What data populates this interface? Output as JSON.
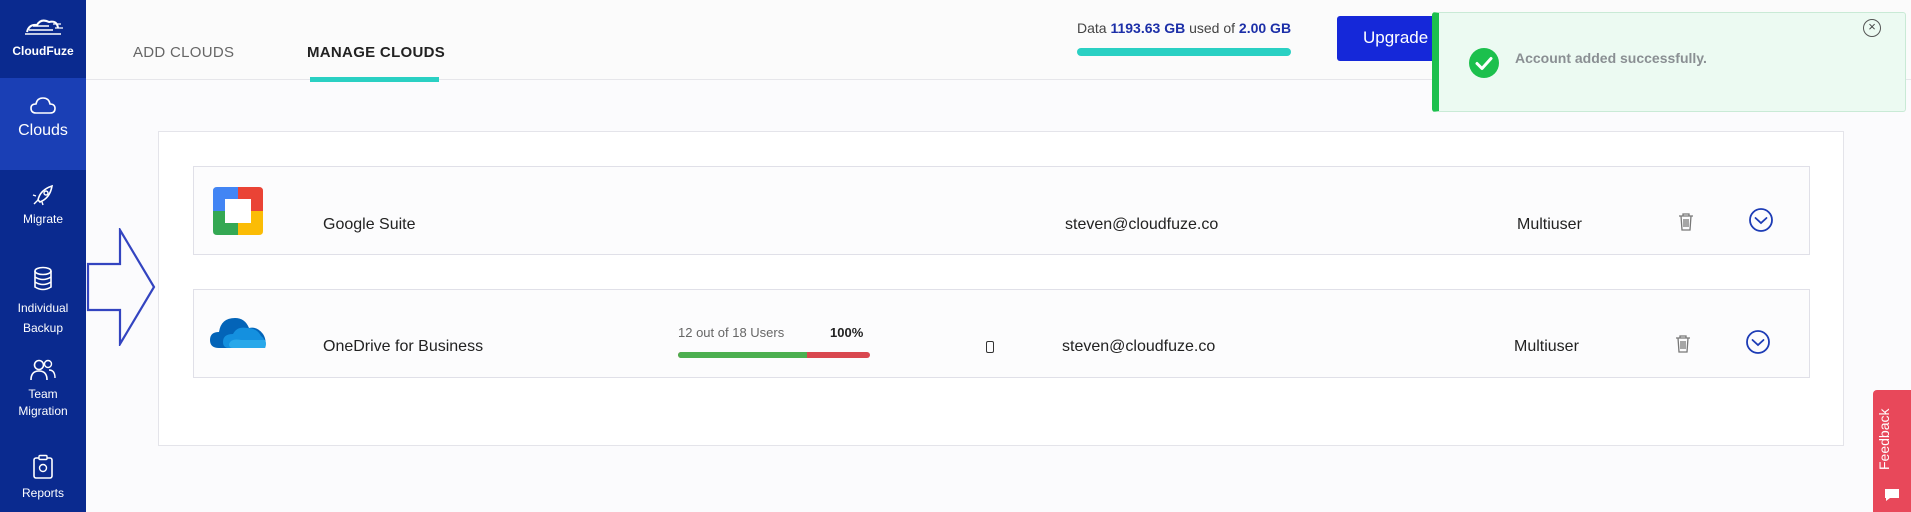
{
  "sidebar": {
    "logo_label": "CloudFuze",
    "items": [
      {
        "label": "Clouds",
        "icon": "cloud-icon"
      },
      {
        "label": "Migrate",
        "icon": "rocket-icon"
      },
      {
        "label_line1": "Individual",
        "label_line2": "Backup",
        "icon": "database-icon"
      },
      {
        "label_line1": "Team",
        "label_line2": "Migration",
        "icon": "users-icon"
      },
      {
        "label": "Reports",
        "icon": "clipboard-icon"
      }
    ]
  },
  "header": {
    "tabs": [
      {
        "label": "ADD CLOUDS"
      },
      {
        "label": "MANAGE CLOUDS"
      }
    ],
    "usage": {
      "prefix": "Data",
      "used": "1193.63 GB",
      "middle": "used of",
      "total": "2.00 GB"
    },
    "upgrade_label": "Upgrade"
  },
  "toast": {
    "message": "Account added successfully.",
    "close": "×"
  },
  "clouds": [
    {
      "name": "Google Suite",
      "email": "steven@cloudfuze.co",
      "type": "Multiuser"
    },
    {
      "name": "OneDrive for Business",
      "users_text": "12 out of 18 Users",
      "users_percent": "100%",
      "users_fraction": 0.67,
      "email": "steven@cloudfuze.co",
      "type": "Multiuser"
    }
  ],
  "feedback_label": "Feedback",
  "colors": {
    "sidebar": "#0a2a8f",
    "accent": "#2ad0c3",
    "upgrade": "#1528d9",
    "success": "#1cc04d",
    "feedback": "#e8485a"
  }
}
